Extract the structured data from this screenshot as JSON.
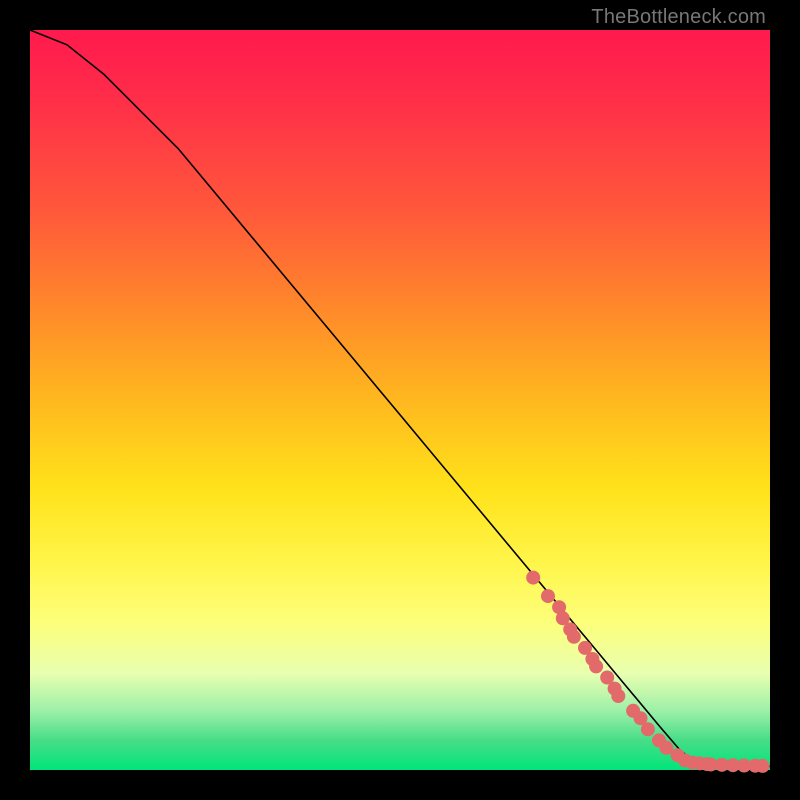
{
  "watermark": "TheBottleneck.com",
  "chart_data": {
    "type": "line",
    "title": "",
    "xlabel": "",
    "ylabel": "",
    "xlim": [
      0,
      100
    ],
    "ylim": [
      0,
      100
    ],
    "curve": {
      "x": [
        0,
        5,
        10,
        15,
        20,
        25,
        30,
        35,
        40,
        45,
        50,
        55,
        60,
        65,
        70,
        75,
        80,
        85,
        88,
        90,
        92,
        94,
        96,
        98,
        100
      ],
      "y": [
        100,
        98,
        94,
        89,
        84,
        78,
        72,
        66,
        60,
        54,
        48,
        42,
        36,
        30,
        24,
        18,
        12,
        6,
        2.5,
        1.2,
        0.8,
        0.6,
        0.5,
        0.5,
        0.5
      ]
    },
    "markers": {
      "x": [
        68,
        70,
        71.5,
        72,
        73,
        73.5,
        75,
        76,
        76.5,
        78,
        79,
        79.5,
        81.5,
        82.5,
        83.5,
        85,
        86,
        87.5,
        88.5,
        89.5,
        90.5,
        91.5,
        92,
        93.5,
        95,
        96.5,
        98,
        99
      ],
      "y": [
        26,
        23.5,
        22,
        20.5,
        19,
        18,
        16.5,
        15,
        14,
        12.5,
        11,
        10,
        8,
        7,
        5.5,
        4,
        3,
        2,
        1.3,
        1.0,
        0.9,
        0.8,
        0.75,
        0.7,
        0.65,
        0.6,
        0.58,
        0.55
      ],
      "color": "#e36a6a",
      "radius": 7
    },
    "line_color": "#000000",
    "line_width": 1.6
  }
}
